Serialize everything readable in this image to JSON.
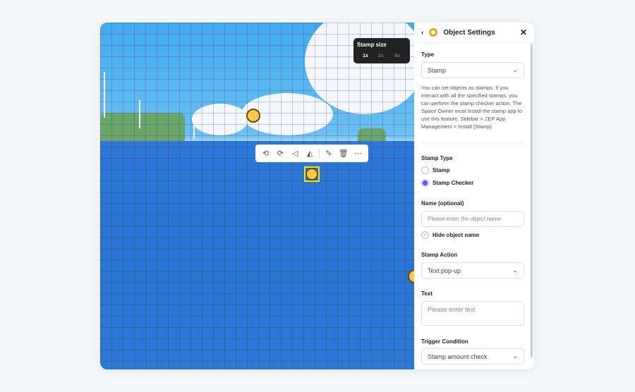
{
  "canvas": {
    "stamp_size": {
      "title": "Stamp size",
      "options": [
        "1x",
        "2x",
        "4x"
      ],
      "selected": "1x"
    },
    "toolbar": [
      {
        "icon": "rotate-left-icon"
      },
      {
        "icon": "rotate-right-icon"
      },
      {
        "icon": "flip-horizontal-icon"
      },
      {
        "icon": "flip-vertical-icon"
      },
      {
        "icon": "edit-icon"
      },
      {
        "icon": "trash-icon"
      },
      {
        "icon": "more-icon"
      }
    ],
    "selection_color": "#f2e600"
  },
  "panel": {
    "title": "Object Settings",
    "type_label": "Type",
    "type_value": "Stamp",
    "help": "You can set objects as stamps. If you interact with all the specified stamps, you can perform the stamp checker action. The Space Owner must install the stamp app to use this feature. Sidebar > ZEP App Management > Install [Stamp]",
    "stamp_type_label": "Stamp Type",
    "stamp_type_options": [
      "Stamp",
      "Stamp Checker"
    ],
    "stamp_type_selected": "Stamp Checker",
    "name_label": "Name (optional)",
    "name_placeholder": "Please enter the object name",
    "hide_name": "Hide object name",
    "action_label": "Stamp Action",
    "action_value": "Text pop-up",
    "text_label": "Text",
    "text_placeholder": "Please enter text",
    "trigger_label": "Trigger Condition",
    "trigger_value": "Stamp amount check",
    "accent": "#5b4ff5"
  }
}
